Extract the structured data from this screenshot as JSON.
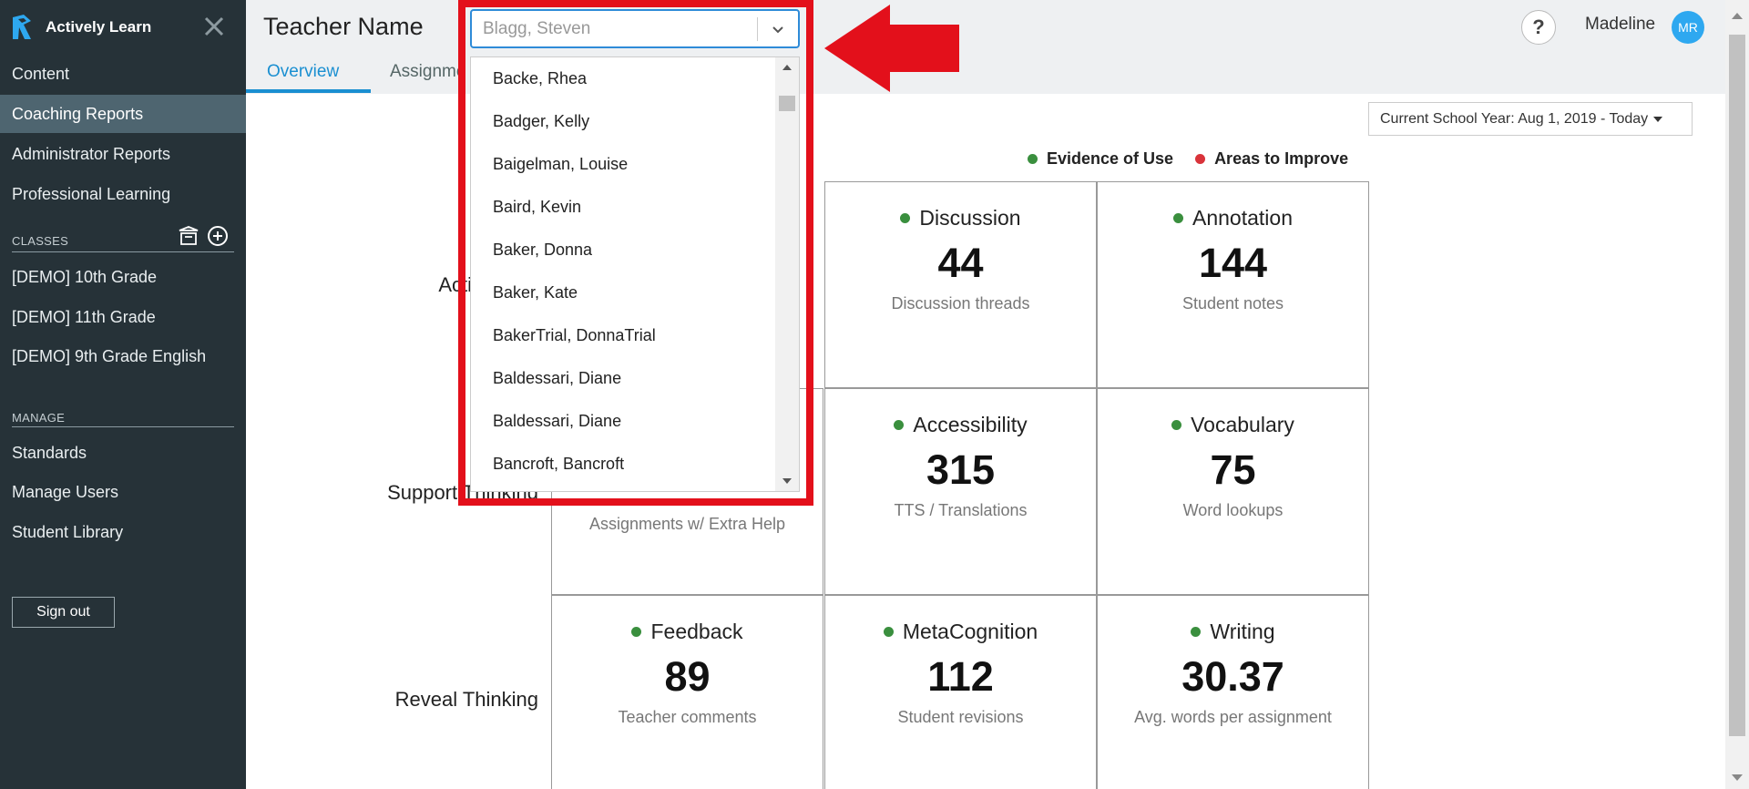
{
  "sidebar": {
    "brand": "Actively Learn",
    "nav_top": [
      "Content",
      "Coaching Reports",
      "Administrator Reports",
      "Professional Learning"
    ],
    "classes_label": "CLASSES",
    "classes": [
      "[DEMO] 10th Grade",
      "[DEMO] 11th Grade",
      "[DEMO] 9th Grade English"
    ],
    "manage_label": "MANAGE",
    "manage": [
      "Standards",
      "Manage Users",
      "Student Library"
    ],
    "signout": "Sign out"
  },
  "header": {
    "title": "Teacher Name",
    "tabs": [
      "Overview",
      "Assignme"
    ],
    "user_name": "Madeline",
    "avatar_initials": "MR",
    "help": "?"
  },
  "teacher_select": {
    "value": "Blagg, Steven",
    "options": [
      "Backe, Rhea",
      "Badger, Kelly",
      "Baigelman, Louise",
      "Baird, Kevin",
      "Baker, Donna",
      "Baker, Kate",
      "BakerTrial, DonnaTrial",
      "Baldessari, Diane",
      "Baldessari, Diane",
      "Bancroft, Bancroft"
    ]
  },
  "date_filter": "Current School Year: Aug 1, 2019 - Today",
  "legend": {
    "evidence": "Evidence of Use",
    "improve": "Areas to Improve"
  },
  "rows": [
    "Activate Th",
    "Support Thinking",
    "Reveal Thinking"
  ],
  "cells": [
    {
      "title": "Discussion",
      "value": "44",
      "sub": "Discussion threads"
    },
    {
      "title": "Annotation",
      "value": "144",
      "sub": "Student notes"
    },
    {
      "sub": "Assignments w/ Extra Help"
    },
    {
      "title": "Accessibility",
      "value": "315",
      "sub": "TTS / Translations"
    },
    {
      "title": "Vocabulary",
      "value": "75",
      "sub": "Word lookups"
    },
    {
      "title": "Feedback",
      "value": "89",
      "sub": "Teacher comments"
    },
    {
      "title": "MetaCognition",
      "value": "112",
      "sub": "Student revisions"
    },
    {
      "title": "Writing",
      "value": "30.37",
      "sub": "Avg. words per assignment"
    }
  ],
  "colors": {
    "sidebar": "#263238",
    "accent": "#1a8fd1",
    "evidence": "#3a8f3e",
    "improve": "#d9333a",
    "highlight": "#e3101b"
  }
}
